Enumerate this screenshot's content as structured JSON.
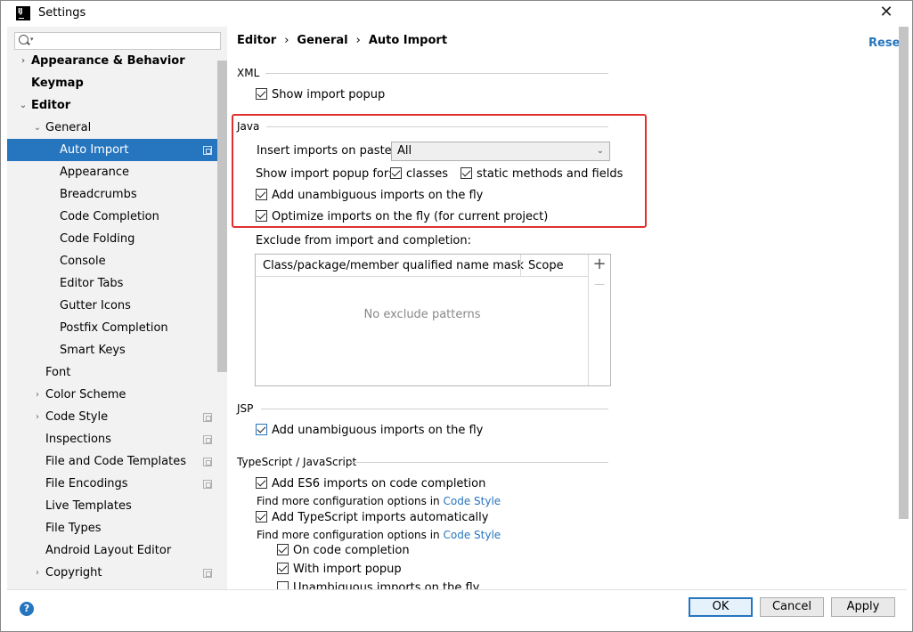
{
  "window": {
    "title": "Settings",
    "app_icon": "IJ"
  },
  "search": {
    "placeholder": ""
  },
  "sidebar": {
    "items": [
      {
        "label": "Appearance & Behavior"
      },
      {
        "label": "Keymap"
      },
      {
        "label": "Editor"
      },
      {
        "label": "General"
      },
      {
        "label": "Auto Import"
      },
      {
        "label": "Appearance"
      },
      {
        "label": "Breadcrumbs"
      },
      {
        "label": "Code Completion"
      },
      {
        "label": "Code Folding"
      },
      {
        "label": "Console"
      },
      {
        "label": "Editor Tabs"
      },
      {
        "label": "Gutter Icons"
      },
      {
        "label": "Postfix Completion"
      },
      {
        "label": "Smart Keys"
      },
      {
        "label": "Font"
      },
      {
        "label": "Color Scheme"
      },
      {
        "label": "Code Style"
      },
      {
        "label": "Inspections"
      },
      {
        "label": "File and Code Templates"
      },
      {
        "label": "File Encodings"
      },
      {
        "label": "Live Templates"
      },
      {
        "label": "File Types"
      },
      {
        "label": "Android Layout Editor"
      },
      {
        "label": "Copyright"
      }
    ]
  },
  "breadcrumb": {
    "part1": "Editor",
    "sep": "›",
    "part2": "General",
    "part3": "Auto Import"
  },
  "reset_label": "Reset",
  "xml": {
    "section": "XML",
    "show_import_popup": "Show import popup"
  },
  "java": {
    "section": "Java",
    "insert_label": "Insert imports on paste:",
    "insert_value": "All",
    "show_popup_for": "Show import popup for:",
    "classes": "classes",
    "static_methods": "static methods and fields",
    "add_unambiguous": "Add unambiguous imports on the fly",
    "optimize": "Optimize imports on the fly (for current project)",
    "exclude_label": "Exclude from import and completion:",
    "table": {
      "col1": "Class/package/member qualified name mask",
      "col2": "Scope",
      "empty": "No exclude patterns",
      "add": "+",
      "remove": "—"
    }
  },
  "jsp": {
    "section": "JSP",
    "add_unambiguous": "Add unambiguous imports on the fly"
  },
  "ts": {
    "section": "TypeScript / JavaScript",
    "add_es6": "Add ES6 imports on code completion",
    "find_more": "Find more configuration options in",
    "code_style_link": "Code Style",
    "add_ts": "Add TypeScript imports automatically",
    "on_completion": "On code completion",
    "with_popup": "With import popup",
    "unambiguous": "Unambiguous imports on the fly"
  },
  "buttons": {
    "ok": "OK",
    "cancel": "Cancel",
    "apply": "Apply",
    "help": "?"
  },
  "colors": {
    "accent": "#2675bf",
    "highlight": "#e03030"
  }
}
